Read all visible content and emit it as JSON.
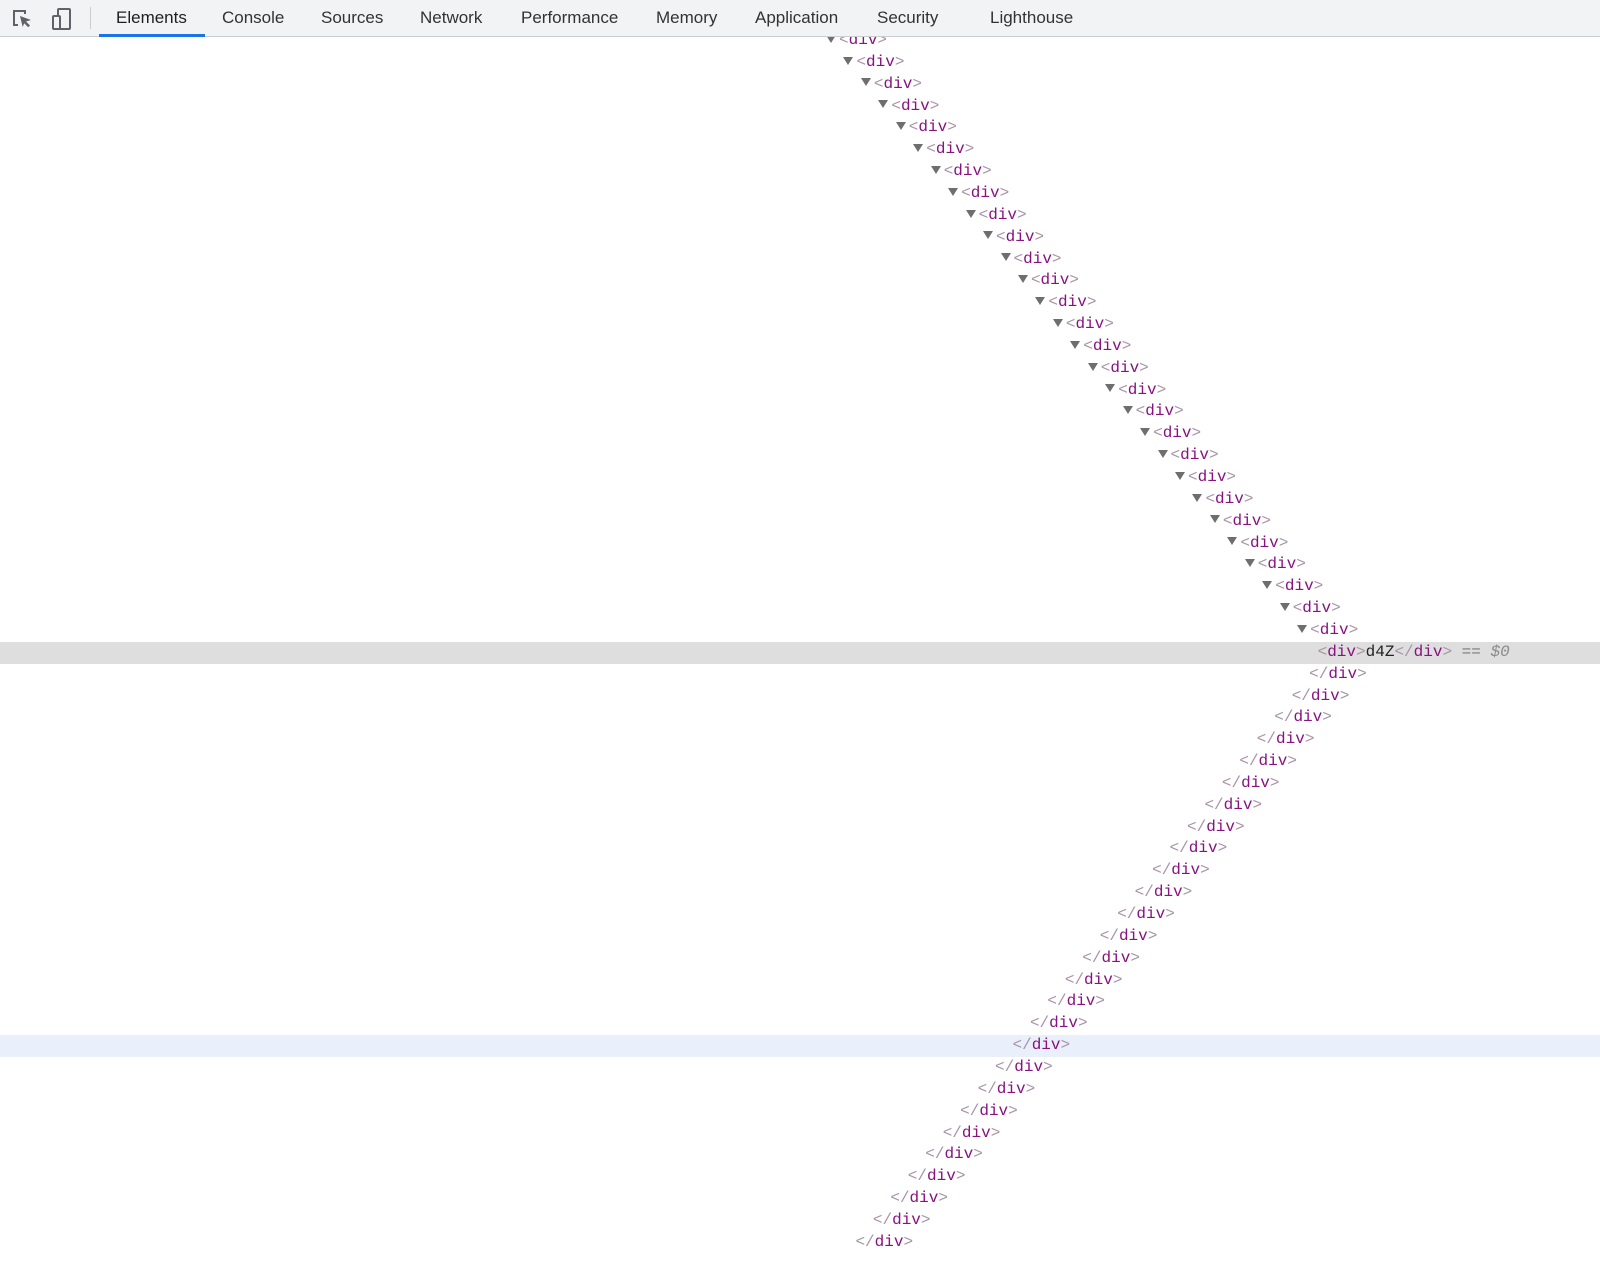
{
  "toolbar": {
    "icons": [
      {
        "name": "inspect-element-icon",
        "label": "Select an element in the page to inspect it"
      },
      {
        "name": "device-toolbar-icon",
        "label": "Toggle device toolbar"
      }
    ],
    "tabs": [
      {
        "label": "Elements",
        "active": true
      },
      {
        "label": "Console",
        "active": false
      },
      {
        "label": "Sources",
        "active": false
      },
      {
        "label": "Network",
        "active": false
      },
      {
        "label": "Performance",
        "active": false
      },
      {
        "label": "Memory",
        "active": false
      },
      {
        "label": "Application",
        "active": false
      },
      {
        "label": "Security",
        "active": false
      },
      {
        "label": "Lighthouse",
        "active": false
      }
    ],
    "accent_color": "#1a73e8"
  },
  "dom_tree": {
    "tag_name": "div",
    "open_rows_visible": 28,
    "selected_node": {
      "tag_name": "div",
      "text": "d4Z",
      "console_ref": "== $0"
    },
    "close_rows_visible": 27,
    "hovered_close_row_index": 17,
    "colors": {
      "tag_name": "#881280",
      "bracket": "#a894a6",
      "selected_row_bg": "#dedede",
      "hovered_row_bg": "#eaf0fb"
    }
  }
}
